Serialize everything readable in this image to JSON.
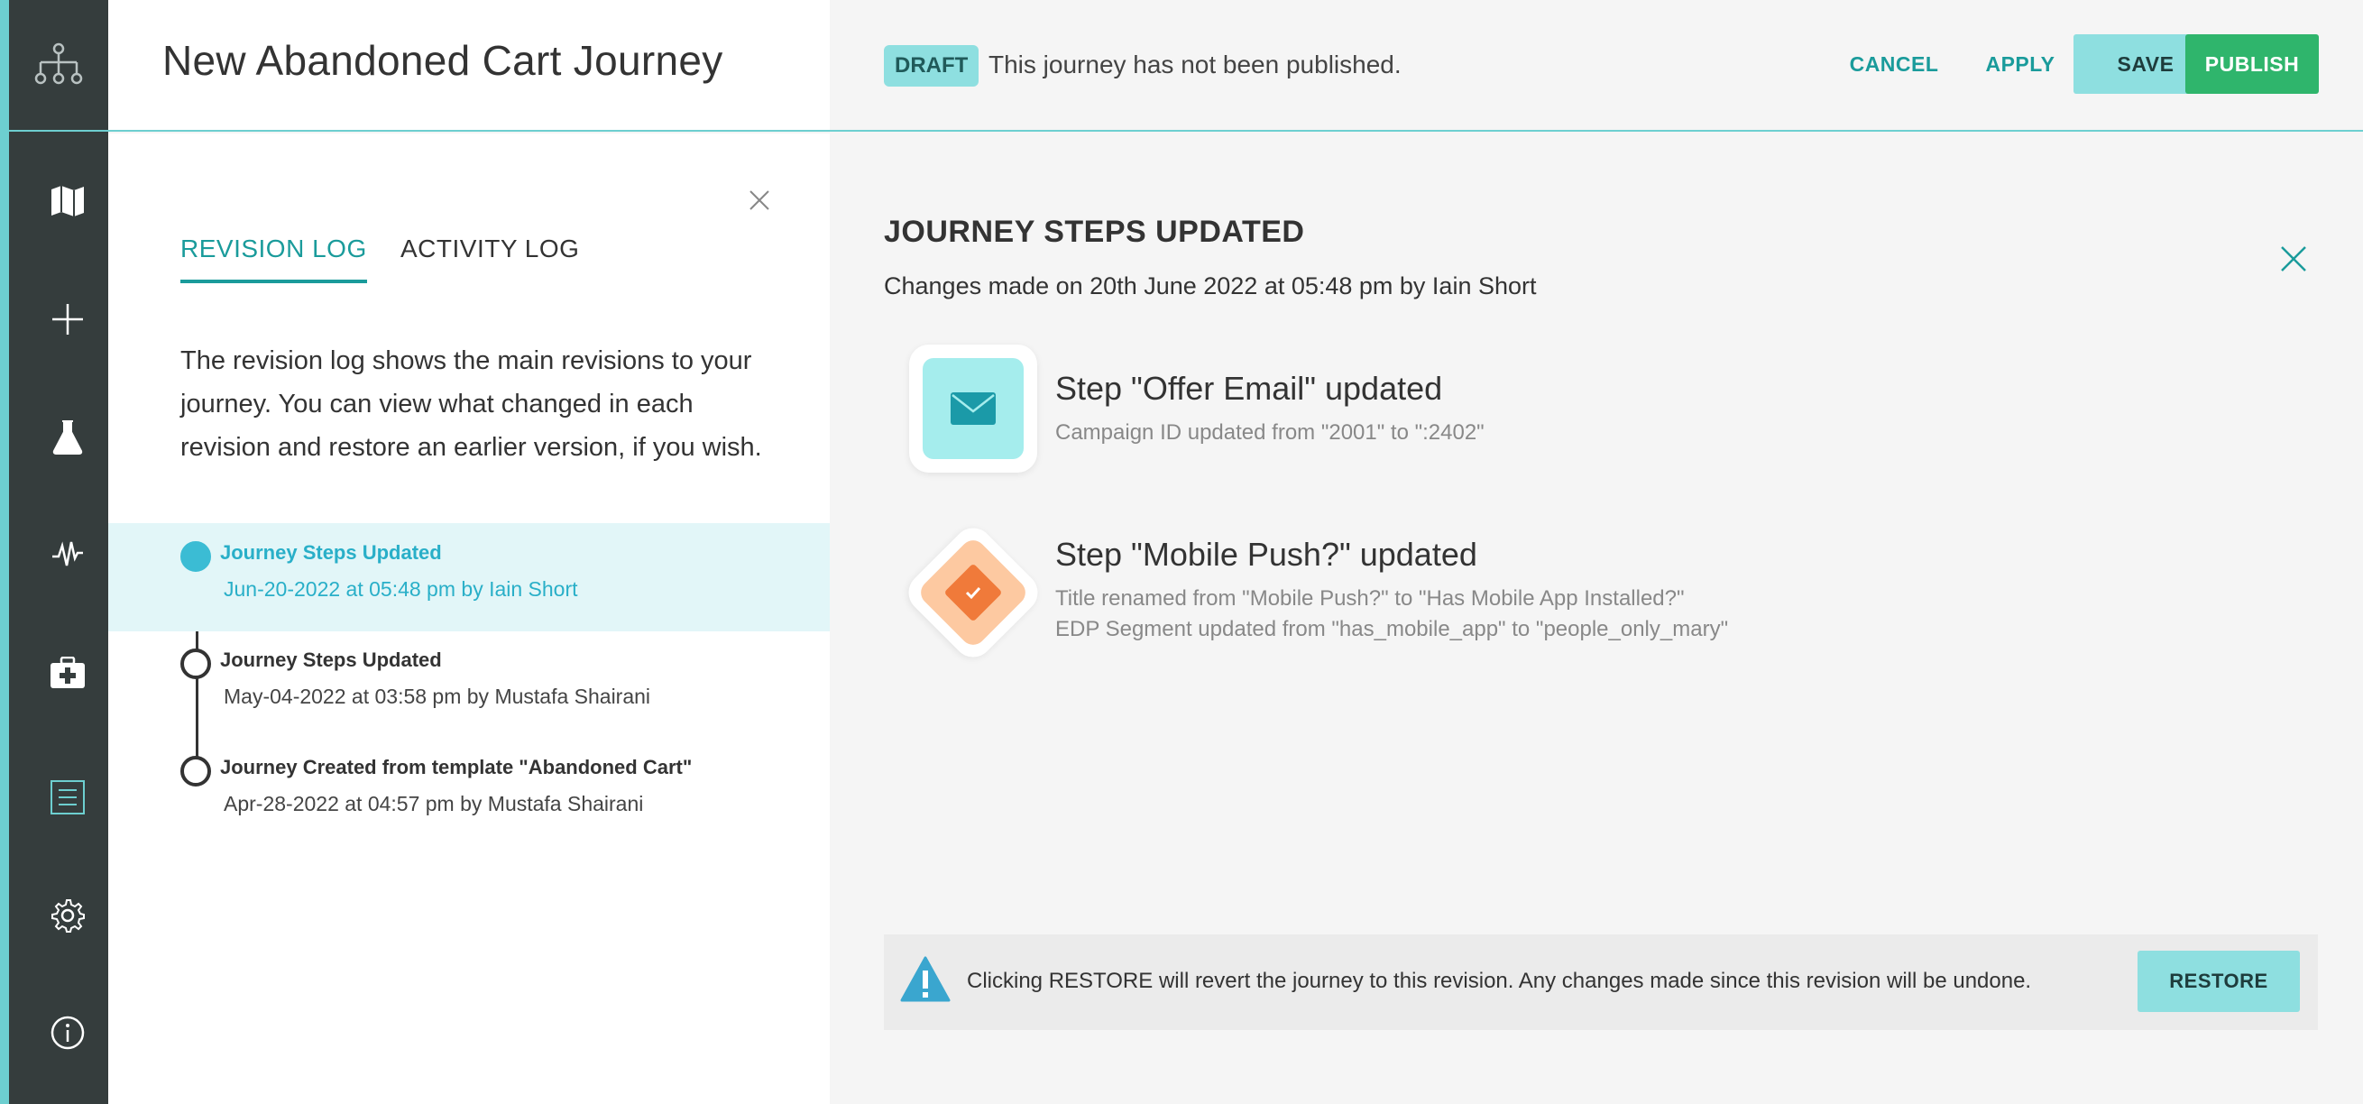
{
  "header": {
    "title": "New Abandoned Cart Journey",
    "status_badge": "DRAFT",
    "status_text": "This journey has not been published.",
    "buttons": {
      "cancel": "CANCEL",
      "apply": "APPLY",
      "save": "SAVE",
      "publish": "PUBLISH"
    }
  },
  "sidebar": {
    "icons": [
      "org-tree-icon",
      "map-icon",
      "plus-icon",
      "flask-icon",
      "pulse-icon",
      "medkit-icon",
      "list-icon",
      "gear-icon",
      "info-icon"
    ]
  },
  "revision_panel": {
    "tabs": [
      {
        "label": "REVISION LOG",
        "active": true
      },
      {
        "label": "ACTIVITY LOG",
        "active": false
      }
    ],
    "intro": "The revision log shows the main revisions to your journey. You can view what changed in each revision and restore an earlier version, if you wish.",
    "revisions": [
      {
        "title": "Journey Steps Updated",
        "meta": "Jun-20-2022 at 05:48 pm by Iain Short",
        "active": true
      },
      {
        "title": "Journey Steps Updated",
        "meta": "May-04-2022 at 03:58 pm by Mustafa Shairani",
        "active": false
      },
      {
        "title": "Journey Created from template \"Abandoned Cart\"",
        "meta": "Apr-28-2022 at 04:57 pm by Mustafa Shairani",
        "active": false
      }
    ]
  },
  "detail": {
    "title": "JOURNEY STEPS UPDATED",
    "subtitle": "Changes made on 20th June 2022 at 05:48 pm by Iain Short",
    "steps": [
      {
        "title": "Step \"Offer Email\" updated",
        "details": [
          "Campaign ID updated from \"2001\" to \":2402\""
        ],
        "icon": "email-icon"
      },
      {
        "title": "Step \"Mobile Push?\" updated",
        "details": [
          "Title renamed from \"Mobile Push?\" to \"Has Mobile App Installed?\"",
          "EDP Segment updated from \"has_mobile_app\" to \"people_only_mary\""
        ],
        "icon": "decision-diamond-icon"
      }
    ],
    "restore": {
      "message": "Clicking RESTORE will revert the journey to this revision. Any changes made since this revision will be undone.",
      "button": "RESTORE"
    }
  },
  "colors": {
    "accent": "#1a9b9b",
    "sidebar_bg": "#353d3d",
    "publish": "#2fb56c",
    "active_revision": "#3bbcd4",
    "warning": "#3aa6cf"
  }
}
